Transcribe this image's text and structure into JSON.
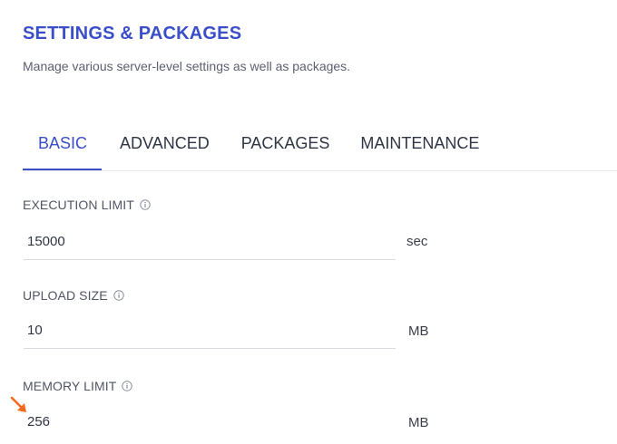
{
  "header": {
    "title": "SETTINGS & PACKAGES",
    "subtitle": "Manage various server-level settings as well as packages."
  },
  "tabs": [
    {
      "label": "BASIC",
      "active": true
    },
    {
      "label": "ADVANCED",
      "active": false
    },
    {
      "label": "PACKAGES",
      "active": false
    },
    {
      "label": "MAINTENANCE",
      "active": false
    }
  ],
  "fields": [
    {
      "label": "EXECUTION LIMIT",
      "value": "15000",
      "unit": "sec"
    },
    {
      "label": "UPLOAD SIZE",
      "value": "10",
      "unit": "MB"
    },
    {
      "label": "MEMORY LIMIT",
      "value": "256",
      "unit": "MB"
    }
  ],
  "icons": {
    "info": "info-circle-icon",
    "cursor": "arrow-pointer-icon"
  },
  "colors": {
    "accent": "#3a4ec8",
    "cursor": "#f26b1d"
  }
}
